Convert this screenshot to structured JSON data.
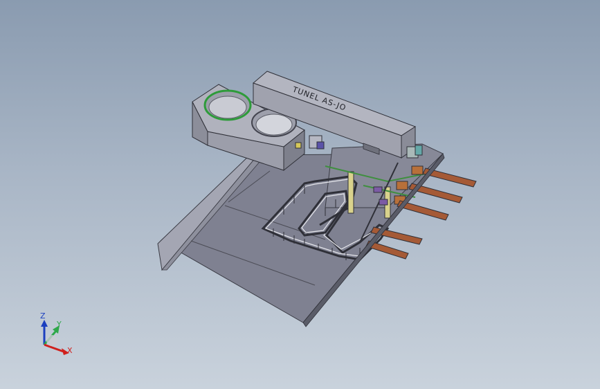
{
  "model": {
    "tunnel_label": "TUNEL AS-JO"
  },
  "triad": {
    "z_label": "Z",
    "y_label": "Y",
    "x_label": "X"
  },
  "colors": {
    "background_top": "#8a9bb0",
    "background_bottom": "#c9d2dc",
    "floor": "#7d7f8f",
    "wall": "#9fa1ae",
    "tunnel": "#a3a5b2",
    "ring_green": "#2e9b3a",
    "conveyor_plate": "#a0522d",
    "axis_x": "#d0201d",
    "axis_y": "#2ea84a",
    "axis_z": "#1b3fbf"
  }
}
